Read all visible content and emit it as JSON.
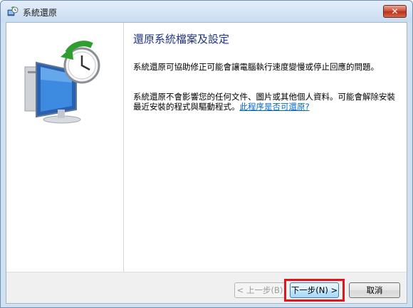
{
  "window": {
    "title": "系統還原",
    "close_label": "✕"
  },
  "content": {
    "heading": "還原系統檔案及設定",
    "paragraph1": "系統還原可協助修正可能會讓電腦執行速度變慢或停止回應的問題。",
    "paragraph2": "系統還原不會影響您的任何文件、圖片或其他個人資料。可能會解除安裝最近安裝的程式與驅動程式。",
    "link": "此程序是否可還原?"
  },
  "buttons": {
    "back": "< 上一步(B)",
    "next": "下一步(N) >",
    "cancel": "取消"
  },
  "icons": {
    "app": "system-restore-icon",
    "hero": "computer-clock-restore-icon"
  },
  "colors": {
    "heading": "#1e3287",
    "link": "#0066cc",
    "highlight": "#e2151c"
  }
}
